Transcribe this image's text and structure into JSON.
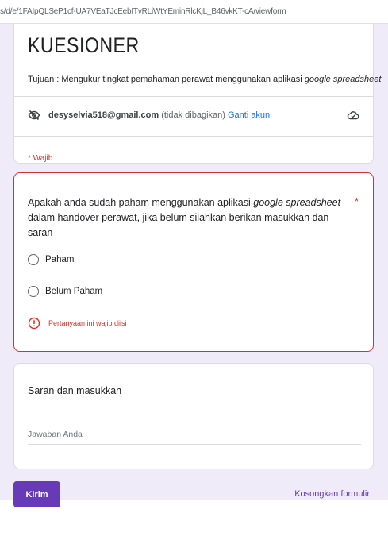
{
  "browser": {
    "url": "s/d/e/1FAIpQLSeP1cf-UA7VEaTJcEebITvRLiWtYEminRlcKjL_B46vkKT-cA/viewform"
  },
  "form": {
    "title": "KUESIONER",
    "description_prefix": "Tujuan : Mengukur tingkat pemahaman perawat menggunakan aplikasi ",
    "description_italic": "google spreadsheet",
    "account": {
      "email": "desyselvia518@gmail.com",
      "note": " (tidak dibagikan) ",
      "switch_label": "Ganti akun",
      "hidden_icon": "eye-off-icon",
      "cloud_icon": "cloud-check-icon"
    },
    "required_note": "* Wajib",
    "question": {
      "text_part1": "Apakah anda sudah paham menggunakan aplikasi ",
      "text_italic": "google spreadsheet",
      "text_part2": " dalam handover perawat, jika belum silahkan berikan masukkan dan saran",
      "required_star": "*",
      "options": [
        {
          "label": "Paham"
        },
        {
          "label": "Belum Paham"
        }
      ],
      "error": "Pertanyaan ini wajib diisi",
      "error_icon": "alert-circle-icon"
    },
    "text_question": {
      "title": "Saran dan masukkan",
      "placeholder": "Jawaban Anda"
    },
    "submit_label": "Kirim",
    "clear_label": "Kosongkan formulir"
  },
  "colors": {
    "accent": "#673ab7",
    "error": "#d93025",
    "link": "#1a73e8",
    "background": "#f0ebf8"
  }
}
